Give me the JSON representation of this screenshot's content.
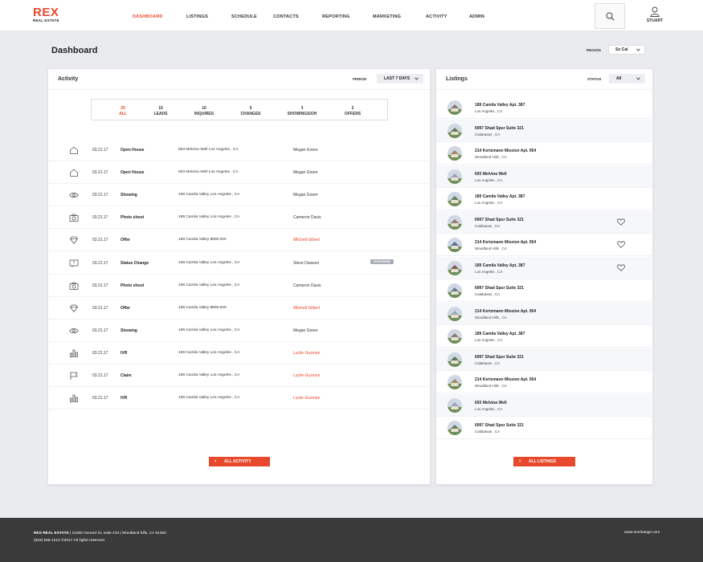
{
  "brand": {
    "name": "REX",
    "sub": "REAL ESTATE",
    "accent_color": "#e8482c"
  },
  "nav": [
    {
      "label": "DASHBOARD",
      "active": true
    },
    {
      "label": "LISTINGS"
    },
    {
      "label": "SCHEDULE"
    },
    {
      "label": "CONTACTS"
    },
    {
      "label": "REPORTING"
    },
    {
      "label": "MARKETING"
    },
    {
      "label": "ACTIVITY"
    },
    {
      "label": "ADMIN"
    }
  ],
  "user": {
    "name": "STUART"
  },
  "page": {
    "title": "Dashboard",
    "region_label": "REGION",
    "region_value": "So Cal"
  },
  "activity": {
    "title": "Activity",
    "period_label": "PERIOD",
    "period_value": "LAST 7 DAYS",
    "stats": [
      {
        "count": "25",
        "label": "ALL",
        "active": true
      },
      {
        "count": "15",
        "label": "LEADS"
      },
      {
        "count": "10",
        "label": "INQUIRES"
      },
      {
        "count": "5",
        "label": "CHANGES"
      },
      {
        "count": "3",
        "label": "SHOWINGS/OH"
      },
      {
        "count": "2",
        "label": "OFFERS"
      }
    ],
    "rows": [
      {
        "icon": "house-icon",
        "date": "03.21.17",
        "type": "Open House",
        "addr": "693 Melvina Well    Los Angeles , CA",
        "person": "Megan Green"
      },
      {
        "icon": "house-icon",
        "date": "03.21.17",
        "type": "Open House",
        "addr": "693 Melvina Well    Los Angeles , CA",
        "person": "Megan Green"
      },
      {
        "icon": "eye-icon",
        "date": "03.21.17",
        "type": "Showing",
        "addr": "189 Camila Valley    Los Angeles , CA",
        "person": "Megan Green"
      },
      {
        "icon": "camera-icon",
        "date": "03.21.17",
        "type": "Photo shoot",
        "addr": "189 Camila Valley    Los Angeles , CA",
        "person": "Cameron Davis"
      },
      {
        "icon": "diamond-icon",
        "date": "03.21.17",
        "type": "Offer",
        "addr": "189 Camila Valley    $890,000",
        "person": "Mitchell Gilbert",
        "red": true
      },
      {
        "icon": "book-icon",
        "date": "03.21.17",
        "type": "Status Change",
        "addr": "189 Camila Valley    Los Angeles , CA",
        "person": "Steve Dawson",
        "badge": "IN ESCROW"
      },
      {
        "icon": "camera-icon",
        "date": "03.21.17",
        "type": "Photo shoot",
        "addr": "189 Camila Valley    Los Angeles , CA",
        "person": "Cameron Davis"
      },
      {
        "icon": "diamond-icon",
        "date": "03.21.17",
        "type": "Offer",
        "addr": "189 Camila Valley    $890,000",
        "person": "Mitchell Gilbert",
        "red": true
      },
      {
        "icon": "eye-icon",
        "date": "03.21.17",
        "type": "Showing",
        "addr": "189 Camila Valley    Los Angeles , CA",
        "person": "Megan Green"
      },
      {
        "icon": "bar-chart-icon",
        "date": "03.21.17",
        "type": "IVR",
        "addr": "189 Camila Valley    Los Angeles , CA",
        "person": "Lucile Guzman",
        "red": true
      },
      {
        "icon": "flag-icon",
        "date": "03.21.17",
        "type": "Claim",
        "addr": "189 Camila Valley    Los Angeles , CA",
        "person": "Lucile Guzman",
        "red": true
      },
      {
        "icon": "bar-chart-icon",
        "date": "03.21.17",
        "type": "IVR",
        "addr": "189 Camila Valley    Los Angeles , CA",
        "person": "Lucile Guzman",
        "red": true
      }
    ],
    "all_button": "ALL ACTIVITY"
  },
  "listings": {
    "title": "Listings",
    "status_label": "STATUS",
    "status_value": "All",
    "rows": [
      {
        "addr1": "189 Camila Valley Apt. 387",
        "addr2": "Los Angeles , CA",
        "thumb": "#8a7a74"
      },
      {
        "addr1": "6997 Shad Spur Suite 321",
        "addr2": "Calabasas , CA",
        "thumb": "#5f7a4e"
      },
      {
        "addr1": "214 Kertzmann Mission Apt. 954",
        "addr2": "Woodland Hills , CA",
        "thumb": "#a08a5a"
      },
      {
        "addr1": "693 Melvina Well",
        "addr2": "Los Angeles , CA",
        "thumb": "#9aa6b8"
      },
      {
        "addr1": "189 Camila Valley Apt. 387",
        "addr2": "Los Angeles , CA",
        "thumb": "#6b7f5a"
      },
      {
        "addr1": "6997 Shad Spur Suite 321",
        "addr2": "Calabasas , CA",
        "thumb": "#8e7d6d",
        "heart": true
      },
      {
        "addr1": "214 Kertzmann Mission Apt. 954",
        "addr2": "Woodland Hills , CA",
        "thumb": "#5a7390",
        "heart": true
      },
      {
        "addr1": "189 Camila Valley Apt. 387",
        "addr2": "Los Angeles , CA",
        "thumb": "#7a5a4a",
        "heart": true
      },
      {
        "addr1": "6997 Shad Spur Suite 321",
        "addr2": "Calabasas , CA",
        "thumb": "#6a7c86"
      },
      {
        "addr1": "214 Kertzmann Mission Apt. 954",
        "addr2": "Woodland Hills , CA",
        "thumb": "#9aa8b0"
      },
      {
        "addr1": "189 Camila Valley Apt. 387",
        "addr2": "Los Angeles , CA",
        "thumb": "#8a7a74"
      },
      {
        "addr1": "6997 Shad Spur Suite 321",
        "addr2": "Calabasas , CA",
        "thumb": "#5f7a4e"
      },
      {
        "addr1": "214 Kertzmann Mission Apt. 954",
        "addr2": "Woodland Hills , CA",
        "thumb": "#a08a5a"
      },
      {
        "addr1": "693 Melvina Well",
        "addr2": "Los Angeles , CA",
        "thumb": "#9aa6b8"
      },
      {
        "addr1": "6997 Shad Spur Suite 321",
        "addr2": "Calabasas , CA",
        "thumb": "#6b7f5a"
      }
    ],
    "all_button": "ALL LISTINGS"
  },
  "footer": {
    "brand": "REX  REAL ESTATE",
    "address": "  |  21500 Oxnard St, suite 210 | Woodland hills, CA 91364",
    "phone_copy": "(818) 555-1212  ©2017 All rights reserved",
    "site": "www.rexchange.com"
  }
}
